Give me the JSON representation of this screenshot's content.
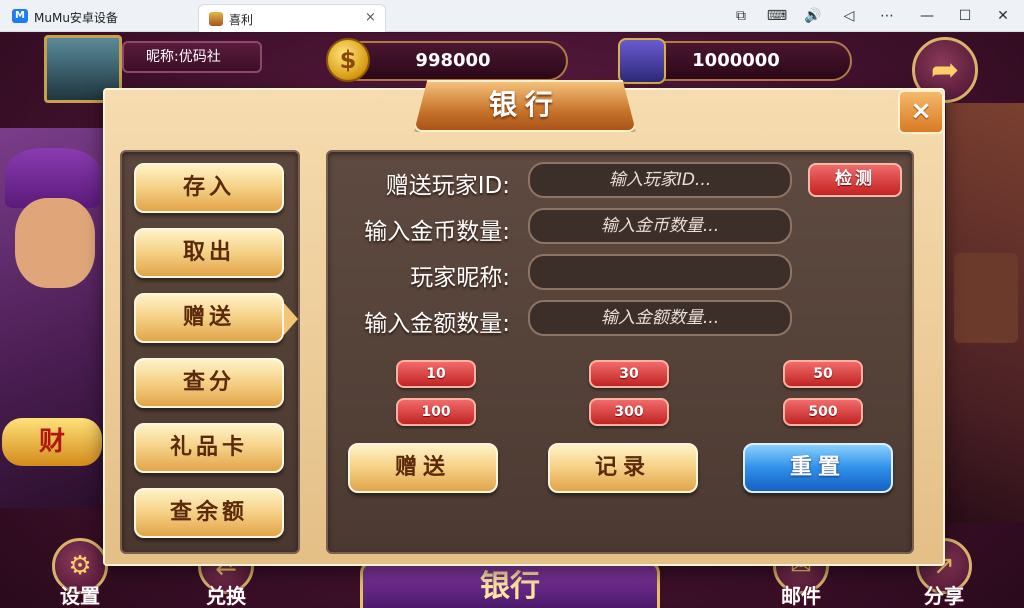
{
  "window": {
    "app_title": "MuMu安卓设备",
    "tab_title": "喜利",
    "tab_close": "×",
    "toolbar_glyphs": [
      "⧉",
      "⌨",
      "🔊",
      "◁",
      "⋯",
      "—",
      "☐",
      "✕"
    ]
  },
  "header": {
    "nickname": "昵称:优码社",
    "gold": "998000",
    "diamond": "1000000"
  },
  "dialog": {
    "title": "银行",
    "close": "×",
    "sidebar": [
      {
        "label": "存入",
        "active": false
      },
      {
        "label": "取出",
        "active": false
      },
      {
        "label": "赠送",
        "active": true
      },
      {
        "label": "查分",
        "active": false
      },
      {
        "label": "礼品卡",
        "active": false
      },
      {
        "label": "查余额",
        "active": false
      }
    ],
    "form": {
      "player_id_label": "赠送玩家ID:",
      "player_id_placeholder": "输入玩家ID...",
      "detect_button": "检测",
      "coin_amount_label": "输入金币数量:",
      "coin_amount_placeholder": "输入金币数量...",
      "nickname_label": "玩家昵称:",
      "nickname_value": "",
      "money_amount_label": "输入金额数量:",
      "money_amount_placeholder": "输入金额数量..."
    },
    "amounts": [
      "10",
      "30",
      "50",
      "100",
      "300",
      "500"
    ],
    "actions": {
      "give": "赠送",
      "record": "记录",
      "reset": "重置"
    }
  },
  "bottom_bar": {
    "settings": "设置",
    "exchange": "兑换",
    "bank": "银行",
    "mail": "邮件",
    "share": "分享"
  },
  "colors": {
    "accent_gold": "#f6d48a",
    "accent_red": "#c42222",
    "accent_blue": "#2f8fe8"
  }
}
